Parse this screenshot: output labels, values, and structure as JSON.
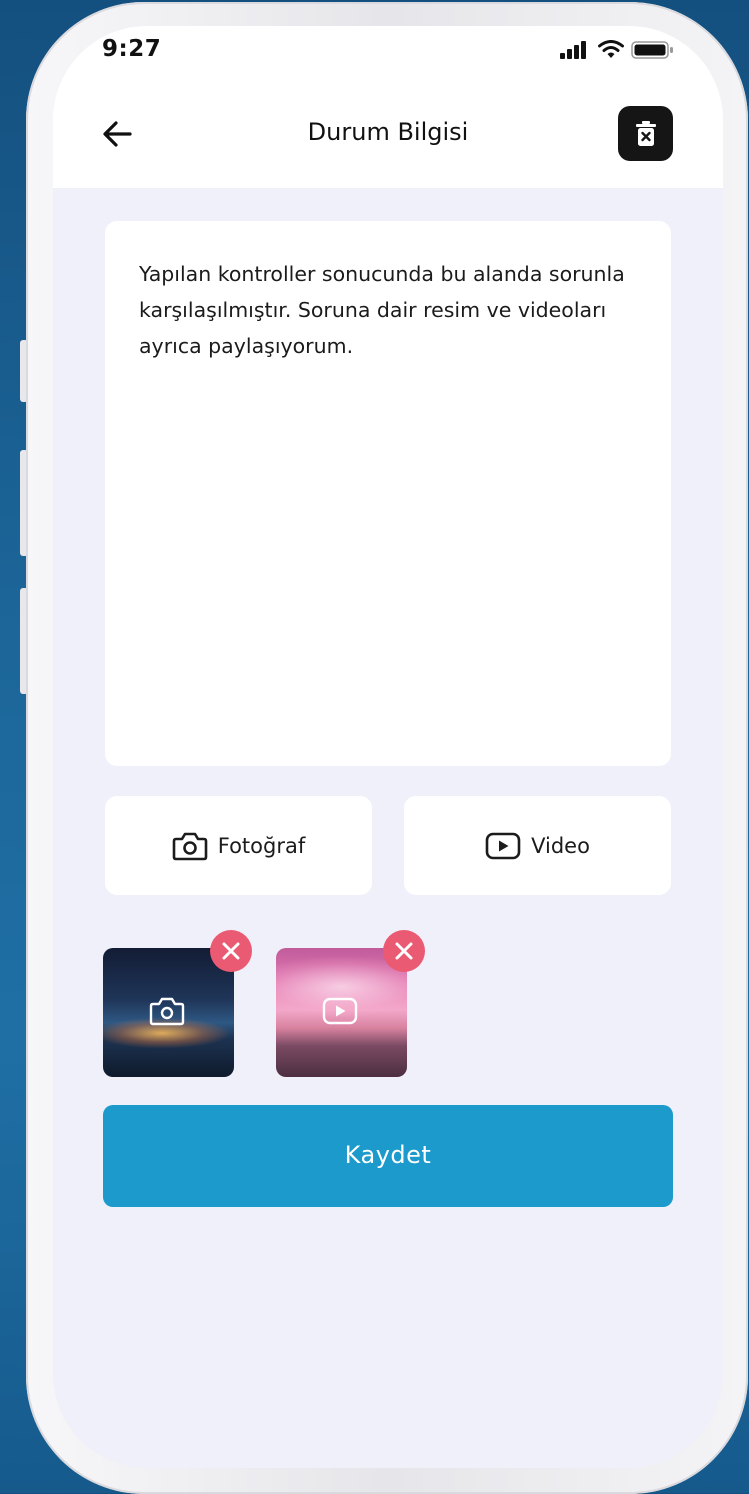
{
  "status_bar": {
    "time": "9:27",
    "icons": [
      "cellular-signal-icon",
      "wifi-icon",
      "battery-icon"
    ]
  },
  "header": {
    "title": "Durum Bilgisi",
    "back_icon": "arrow-left-icon",
    "delete_icon": "trash-icon"
  },
  "note": {
    "text": "Yapılan kontroller sonucunda bu alanda sorunla karşılaşılmıştır. Soruna dair resim ve videoları ayrıca paylaşıyorum."
  },
  "media_buttons": {
    "photo_label": "Fotoğraf",
    "photo_icon": "camera-icon",
    "video_label": "Video",
    "video_icon": "play-icon"
  },
  "attachments": [
    {
      "type": "photo",
      "icon": "camera-icon",
      "remove_icon": "close-icon"
    },
    {
      "type": "video",
      "icon": "play-icon",
      "remove_icon": "close-icon"
    }
  ],
  "save_button": {
    "label": "Kaydet"
  },
  "colors": {
    "accent": "#1b9acb",
    "remove": "#ea5a72",
    "screen_background": "#eff0f9",
    "page_background": "#1c6598"
  }
}
